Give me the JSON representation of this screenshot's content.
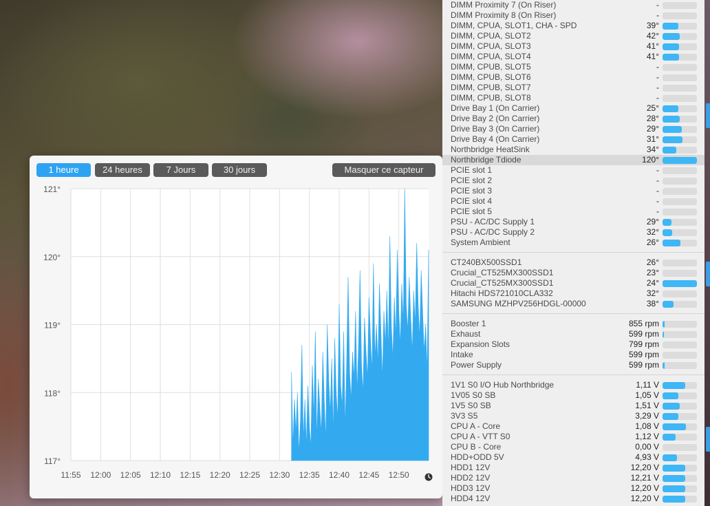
{
  "chart_toolbar": {
    "range_buttons": [
      "1 heure",
      "24 heures",
      "7 Jours",
      "30 jours"
    ],
    "active_range": 0,
    "hide_button": "Masquer ce capteur"
  },
  "chart_data": {
    "type": "area",
    "ylim": [
      117,
      121
    ],
    "yticks": [
      "117°",
      "118°",
      "119°",
      "120°",
      "121°"
    ],
    "xticks": [
      "11:55",
      "12:00",
      "12:05",
      "12:10",
      "12:15",
      "12:20",
      "12:25",
      "12:30",
      "12:35",
      "12:40",
      "12:45",
      "12:50"
    ],
    "x_start": "11:55",
    "x_end": "12:55",
    "data_start": "12:32",
    "color": "#33aaf0",
    "values": [
      118.3,
      117.2,
      117.9,
      117.4,
      118.0,
      117.1,
      117.6,
      118.7,
      117.3,
      117.9,
      117.2,
      118.1,
      117.5,
      117.2,
      118.4,
      117.6,
      118.9,
      117.3,
      118.2,
      117.8,
      117.4,
      118.6,
      117.9,
      117.3,
      119.0,
      118.2,
      117.7,
      118.5,
      117.4,
      118.8,
      118.0,
      117.6,
      119.3,
      118.1,
      117.8,
      118.9,
      117.5,
      118.4,
      119.7,
      118.3,
      117.9,
      118.6,
      118.2,
      119.2,
      118.0,
      118.7,
      119.8,
      118.4,
      118.0,
      119.1,
      118.6,
      118.2,
      119.4,
      118.8,
      118.3,
      119.9,
      118.5,
      119.0,
      118.4,
      119.6,
      118.9,
      118.2,
      119.2,
      118.7,
      119.5,
      118.6,
      120.3,
      119.0,
      118.5,
      119.4,
      118.8,
      120.1,
      119.2,
      118.7,
      119.6,
      119.0,
      121.0,
      119.3,
      118.9,
      119.7,
      119.1,
      118.6,
      119.5,
      119.0,
      120.2,
      119.3,
      118.8,
      119.8,
      119.2,
      118.6,
      119.0,
      118.3,
      120.1
    ]
  },
  "sensors": {
    "group1": [
      {
        "label": "DIMM Proximity 7 (On Riser)",
        "value": "-",
        "fill": 0
      },
      {
        "label": "DIMM Proximity 8 (On Riser)",
        "value": "-",
        "fill": 0
      },
      {
        "label": "DIMM, CPUA, SLOT1, CHA - SPD",
        "value": "39°",
        "fill": 0.45
      },
      {
        "label": "DIMM, CPUA, SLOT2",
        "value": "42°",
        "fill": 0.5
      },
      {
        "label": "DIMM, CPUA, SLOT3",
        "value": "41°",
        "fill": 0.48
      },
      {
        "label": "DIMM, CPUA, SLOT4",
        "value": "41°",
        "fill": 0.48
      },
      {
        "label": "DIMM, CPUB, SLOT5",
        "value": "-",
        "fill": 0
      },
      {
        "label": "DIMM, CPUB, SLOT6",
        "value": "-",
        "fill": 0
      },
      {
        "label": "DIMM, CPUB, SLOT7",
        "value": "-",
        "fill": 0
      },
      {
        "label": "DIMM, CPUB, SLOT8",
        "value": "-",
        "fill": 0
      },
      {
        "label": "Drive Bay 1 (On Carrier)",
        "value": "25°",
        "fill": 0.45
      },
      {
        "label": "Drive Bay 2 (On Carrier)",
        "value": "28°",
        "fill": 0.5
      },
      {
        "label": "Drive Bay 3 (On Carrier)",
        "value": "29°",
        "fill": 0.55
      },
      {
        "label": "Drive Bay 4 (On Carrier)",
        "value": "31°",
        "fill": 0.58
      },
      {
        "label": "Northbridge HeatSink",
        "value": "34°",
        "fill": 0.4
      },
      {
        "label": "Northbridge Tdiode",
        "value": "120°",
        "fill": 1.0,
        "highlight": true
      },
      {
        "label": "PCIE slot 1",
        "value": "-",
        "fill": 0
      },
      {
        "label": "PCIE slot 2",
        "value": "-",
        "fill": 0
      },
      {
        "label": "PCIE slot 3",
        "value": "-",
        "fill": 0
      },
      {
        "label": "PCIE slot 4",
        "value": "-",
        "fill": 0
      },
      {
        "label": "PCIE slot 5",
        "value": "-",
        "fill": 0
      },
      {
        "label": "PSU - AC/DC Supply 1",
        "value": "29°",
        "fill": 0.25
      },
      {
        "label": "PSU - AC/DC Supply 2",
        "value": "32°",
        "fill": 0.28
      },
      {
        "label": "System Ambient",
        "value": "26°",
        "fill": 0.52
      }
    ],
    "group2": [
      {
        "label": "CT240BX500SSD1",
        "value": "26°",
        "fill": 0
      },
      {
        "label": "Crucial_CT525MX300SSD1",
        "value": "23°",
        "fill": 0
      },
      {
        "label": "Crucial_CT525MX300SSD1",
        "value": "24°",
        "fill": 1.0
      },
      {
        "label": "Hitachi HDS721010CLA332",
        "value": "32°",
        "fill": 0
      },
      {
        "label": "SAMSUNG MZHPV256HDGL-00000",
        "value": "38°",
        "fill": 0.32
      }
    ],
    "group3": [
      {
        "label": "Booster 1",
        "value": "855 rpm",
        "fill": 0.05
      },
      {
        "label": "Exhaust",
        "value": "599 rpm",
        "fill": 0.03
      },
      {
        "label": "Expansion Slots",
        "value": "799 rpm",
        "fill": 0
      },
      {
        "label": "Intake",
        "value": "599 rpm",
        "fill": 0
      },
      {
        "label": "Power Supply",
        "value": "599 rpm",
        "fill": 0.06
      }
    ],
    "group4": [
      {
        "label": "1V1 S0 I/O Hub Northbridge",
        "value": "1,11 V",
        "fill": 0.65
      },
      {
        "label": "1V05 S0 SB",
        "value": "1,05 V",
        "fill": 0.45
      },
      {
        "label": "1V5 S0 SB",
        "value": "1,51 V",
        "fill": 0.5
      },
      {
        "label": "3V3 S5",
        "value": "3,29 V",
        "fill": 0.45
      },
      {
        "label": "CPU A - Core",
        "value": "1,08 V",
        "fill": 0.68
      },
      {
        "label": "CPU A - VTT S0",
        "value": "1,12 V",
        "fill": 0.38
      },
      {
        "label": "CPU B - Core",
        "value": "0,00 V",
        "fill": 0
      },
      {
        "label": "HDD+ODD 5V",
        "value": "4,93 V",
        "fill": 0.42
      },
      {
        "label": "HDD1 12V",
        "value": "12,20 V",
        "fill": 0.66
      },
      {
        "label": "HDD2 12V",
        "value": "12,21 V",
        "fill": 0.66
      },
      {
        "label": "HDD3 12V",
        "value": "12,20 V",
        "fill": 0.66
      },
      {
        "label": "HDD4 12V",
        "value": "12,20 V",
        "fill": 0.66
      }
    ]
  }
}
